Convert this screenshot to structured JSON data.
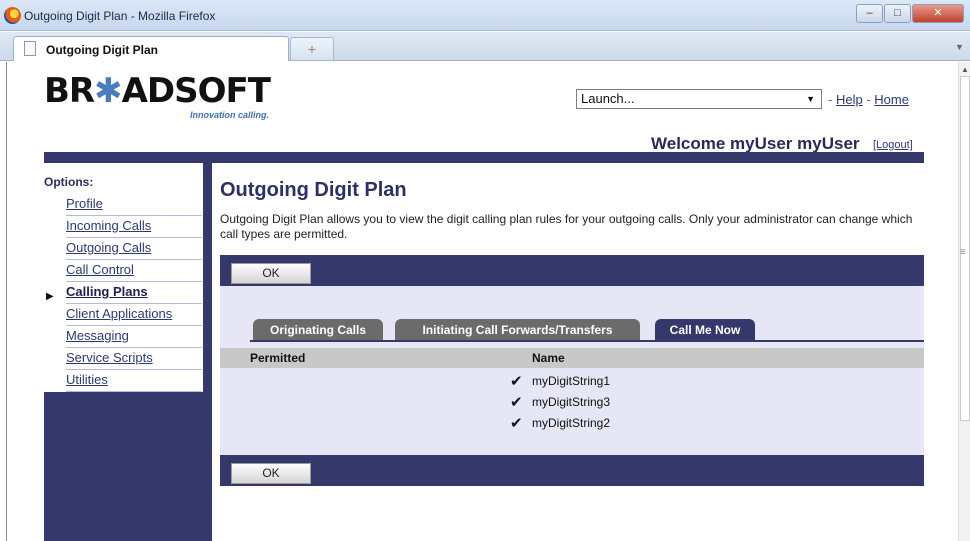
{
  "window": {
    "title": "Outgoing Digit Plan - Mozilla Firefox",
    "controls": {
      "minimize": "–",
      "maximize": "□",
      "close": "✕"
    }
  },
  "browser": {
    "tab_label": "Outgoing Digit Plan",
    "new_tab": "+"
  },
  "header": {
    "logo_prefix": "BR",
    "logo_star": "✱",
    "logo_suffix": "ADSOFT",
    "tagline": "Innovation calling.",
    "launch_value": "Launch...",
    "launch_arrow": "▼",
    "sep1": " - ",
    "help": "Help",
    "sep2": " - ",
    "home": "Home",
    "welcome": "Welcome myUser myUser",
    "logout": "[Logout]"
  },
  "sidebar": {
    "title": "Options:",
    "pointer": "▶",
    "items": [
      {
        "label": "Profile"
      },
      {
        "label": "Incoming Calls"
      },
      {
        "label": "Outgoing Calls"
      },
      {
        "label": "Call Control"
      },
      {
        "label": "Calling Plans",
        "active": true
      },
      {
        "label": "Client Applications"
      },
      {
        "label": "Messaging"
      },
      {
        "label": "Service Scripts"
      },
      {
        "label": "Utilities"
      }
    ]
  },
  "main": {
    "title": "Outgoing Digit Plan",
    "description": "Outgoing Digit Plan allows you to view the digit calling plan rules for your outgoing calls. Only your administrator can change which call types are permitted.",
    "ok_label": "OK",
    "tabs": [
      {
        "label": "Originating Calls"
      },
      {
        "label": "Initiating Call Forwards/Transfers"
      },
      {
        "label": "Call Me Now",
        "active": true
      }
    ],
    "table": {
      "headers": [
        "Permitted",
        "Name"
      ],
      "rows": [
        {
          "permitted": true,
          "check": "✔",
          "name": "myDigitString1"
        },
        {
          "permitted": true,
          "check": "✔",
          "name": "myDigitString3"
        },
        {
          "permitted": true,
          "check": "✔",
          "name": "myDigitString2"
        }
      ]
    }
  },
  "colors": {
    "band": "#35386b",
    "panel": "#e6e6f7",
    "link": "#2c3a73"
  }
}
